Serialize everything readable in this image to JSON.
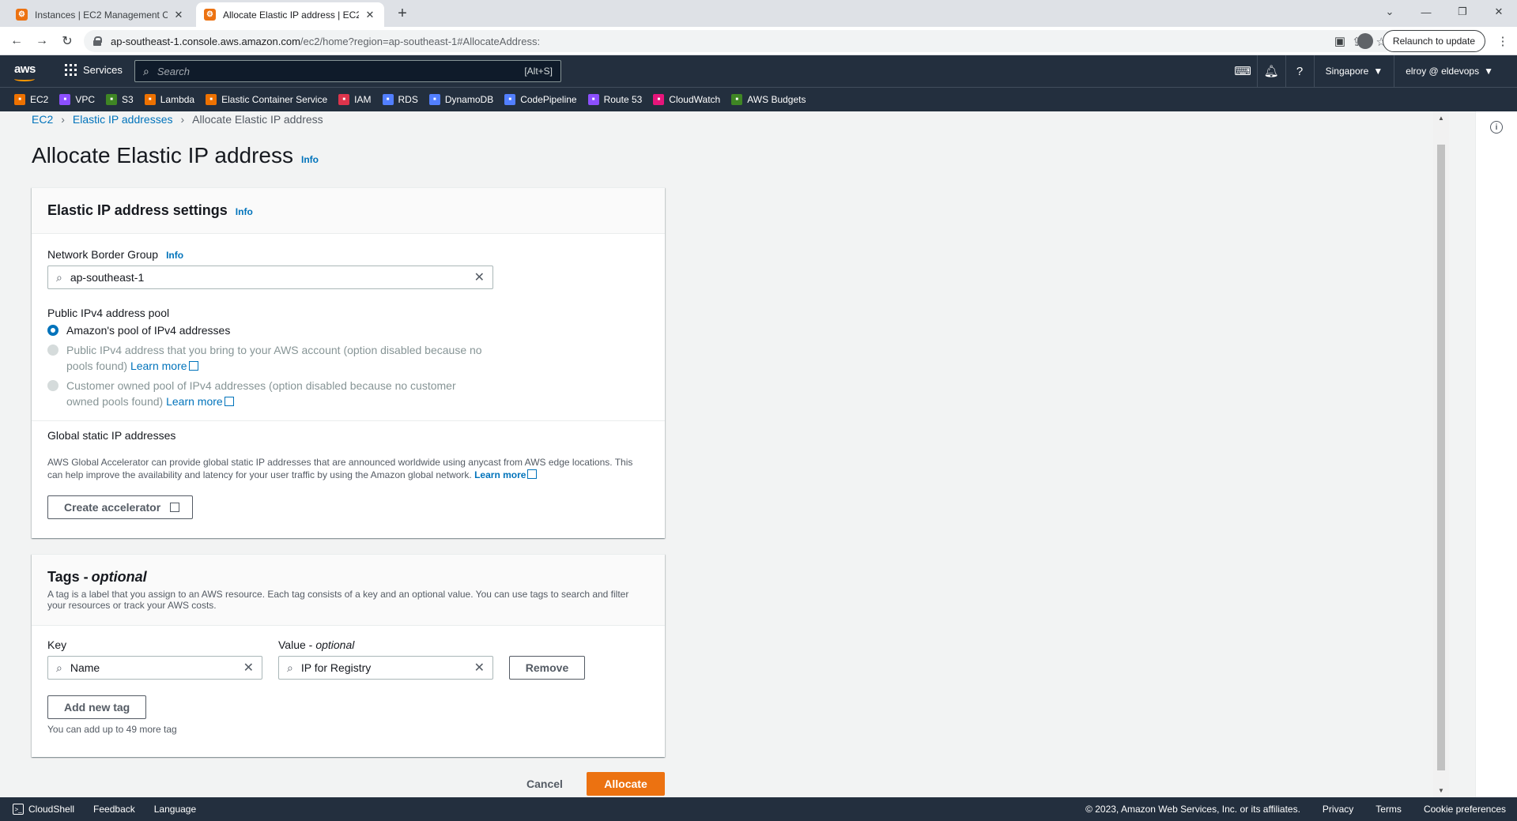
{
  "browser": {
    "tabs": [
      {
        "title": "Instances | EC2 Management Console",
        "active": false
      },
      {
        "title": "Allocate Elastic IP address | EC2 Management Console",
        "active": true
      }
    ],
    "url_host": "ap-southeast-1.console.aws.amazon.com",
    "url_path": "/ec2/home?region=ap-southeast-1#AllocateAddress:",
    "relaunch_label": "Relaunch to update"
  },
  "aws_header": {
    "logo": "aws",
    "services_label": "Services",
    "search_placeholder": "Search",
    "search_shortcut": "[Alt+S]",
    "region": "Singapore",
    "account": "elroy @ eldevops"
  },
  "favorites": [
    {
      "label": "EC2",
      "color": "#ed7100",
      "icon": "ec2-icon"
    },
    {
      "label": "VPC",
      "color": "#8c4fff",
      "icon": "vpc-icon"
    },
    {
      "label": "S3",
      "color": "#3f8624",
      "icon": "s3-icon"
    },
    {
      "label": "Lambda",
      "color": "#ed7100",
      "icon": "lambda-icon"
    },
    {
      "label": "Elastic Container Service",
      "color": "#ed7100",
      "icon": "ecs-icon"
    },
    {
      "label": "IAM",
      "color": "#dd344c",
      "icon": "iam-icon"
    },
    {
      "label": "RDS",
      "color": "#527fff",
      "icon": "rds-icon"
    },
    {
      "label": "DynamoDB",
      "color": "#527fff",
      "icon": "dynamodb-icon"
    },
    {
      "label": "CodePipeline",
      "color": "#527fff",
      "icon": "codepipeline-icon"
    },
    {
      "label": "Route 53",
      "color": "#8c4fff",
      "icon": "route53-icon"
    },
    {
      "label": "CloudWatch",
      "color": "#e7157b",
      "icon": "cloudwatch-icon"
    },
    {
      "label": "AWS Budgets",
      "color": "#3f8624",
      "icon": "budgets-icon"
    }
  ],
  "breadcrumb": {
    "items": [
      "EC2",
      "Elastic IP addresses"
    ],
    "current": "Allocate Elastic IP address"
  },
  "page": {
    "title": "Allocate Elastic IP address",
    "info": "Info"
  },
  "settings": {
    "title": "Elastic IP address settings",
    "info": "Info",
    "network_border_group": {
      "label": "Network Border Group",
      "info": "Info",
      "value": "ap-southeast-1"
    },
    "pool": {
      "label": "Public IPv4 address pool",
      "options": [
        {
          "text": "Amazon's pool of IPv4 addresses",
          "selected": true,
          "disabled": false
        },
        {
          "text": "Public IPv4 address that you bring to your AWS account (option disabled because no pools found)",
          "selected": false,
          "disabled": true,
          "link": "Learn more"
        },
        {
          "text": "Customer owned pool of IPv4 addresses (option disabled because no customer owned pools found)",
          "selected": false,
          "disabled": true,
          "link": "Learn more"
        }
      ]
    },
    "global_static": {
      "label": "Global static IP addresses",
      "description": "AWS Global Accelerator can provide global static IP addresses that are announced worldwide using anycast from AWS edge locations. This can help improve the availability and latency for your user traffic by using the Amazon global network.",
      "link": "Learn more",
      "button": "Create accelerator"
    }
  },
  "tags": {
    "title": "Tags - ",
    "title_optional": "optional",
    "description": "A tag is a label that you assign to an AWS resource. Each tag consists of a key and an optional value. You can use tags to search and filter your resources or track your AWS costs.",
    "key_label": "Key",
    "value_label": "Value - ",
    "value_optional": "optional",
    "key_value": "Name",
    "value_value": "IP for Registry",
    "remove_label": "Remove",
    "add_label": "Add new tag",
    "limit_text": "You can add up to 49 more tag"
  },
  "actions": {
    "cancel": "Cancel",
    "allocate": "Allocate"
  },
  "footer": {
    "cloudshell": "CloudShell",
    "feedback": "Feedback",
    "language": "Language",
    "copyright": "© 2023, Amazon Web Services, Inc. or its affiliates.",
    "privacy": "Privacy",
    "terms": "Terms",
    "cookies": "Cookie preferences"
  }
}
